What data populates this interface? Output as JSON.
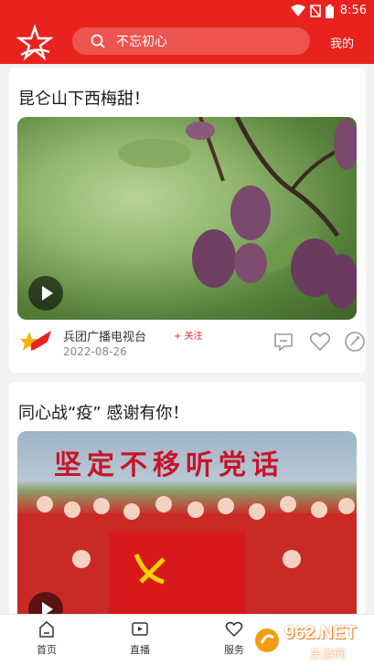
{
  "status_bar": {
    "time": "8:56"
  },
  "header": {
    "search_placeholder": "不忘初心",
    "mine_label": "我的"
  },
  "feed": [
    {
      "title": "昆仑山下西梅甜！",
      "source": "兵团广播电视台",
      "follow_label": "+ 关注",
      "date": "2022-08-26"
    },
    {
      "title": "同心战“疫” 感谢有你！",
      "banner_text": "坚定不移听党话"
    }
  ],
  "tabbar": [
    {
      "label": "首页",
      "icon": "home-icon"
    },
    {
      "label": "直播",
      "icon": "live-icon"
    },
    {
      "label": "服务",
      "icon": "heart-icon"
    }
  ],
  "watermark": {
    "text": "962.NET",
    "sub": "乐游网"
  },
  "colors": {
    "brand_red": "#e8231e"
  }
}
